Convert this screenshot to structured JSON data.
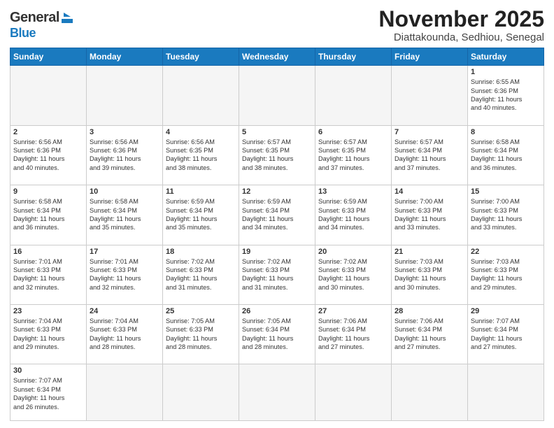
{
  "header": {
    "logo_line1": "General",
    "logo_line2": "Blue",
    "month_title": "November 2025",
    "location": "Diattakounda, Sedhiou, Senegal"
  },
  "weekdays": [
    "Sunday",
    "Monday",
    "Tuesday",
    "Wednesday",
    "Thursday",
    "Friday",
    "Saturday"
  ],
  "weeks": [
    [
      {
        "day": "",
        "info": ""
      },
      {
        "day": "",
        "info": ""
      },
      {
        "day": "",
        "info": ""
      },
      {
        "day": "",
        "info": ""
      },
      {
        "day": "",
        "info": ""
      },
      {
        "day": "",
        "info": ""
      },
      {
        "day": "1",
        "info": "Sunrise: 6:55 AM\nSunset: 6:36 PM\nDaylight: 11 hours\nand 40 minutes."
      }
    ],
    [
      {
        "day": "2",
        "info": "Sunrise: 6:56 AM\nSunset: 6:36 PM\nDaylight: 11 hours\nand 40 minutes."
      },
      {
        "day": "3",
        "info": "Sunrise: 6:56 AM\nSunset: 6:36 PM\nDaylight: 11 hours\nand 39 minutes."
      },
      {
        "day": "4",
        "info": "Sunrise: 6:56 AM\nSunset: 6:35 PM\nDaylight: 11 hours\nand 38 minutes."
      },
      {
        "day": "5",
        "info": "Sunrise: 6:57 AM\nSunset: 6:35 PM\nDaylight: 11 hours\nand 38 minutes."
      },
      {
        "day": "6",
        "info": "Sunrise: 6:57 AM\nSunset: 6:35 PM\nDaylight: 11 hours\nand 37 minutes."
      },
      {
        "day": "7",
        "info": "Sunrise: 6:57 AM\nSunset: 6:34 PM\nDaylight: 11 hours\nand 37 minutes."
      },
      {
        "day": "8",
        "info": "Sunrise: 6:58 AM\nSunset: 6:34 PM\nDaylight: 11 hours\nand 36 minutes."
      }
    ],
    [
      {
        "day": "9",
        "info": "Sunrise: 6:58 AM\nSunset: 6:34 PM\nDaylight: 11 hours\nand 36 minutes."
      },
      {
        "day": "10",
        "info": "Sunrise: 6:58 AM\nSunset: 6:34 PM\nDaylight: 11 hours\nand 35 minutes."
      },
      {
        "day": "11",
        "info": "Sunrise: 6:59 AM\nSunset: 6:34 PM\nDaylight: 11 hours\nand 35 minutes."
      },
      {
        "day": "12",
        "info": "Sunrise: 6:59 AM\nSunset: 6:34 PM\nDaylight: 11 hours\nand 34 minutes."
      },
      {
        "day": "13",
        "info": "Sunrise: 6:59 AM\nSunset: 6:33 PM\nDaylight: 11 hours\nand 34 minutes."
      },
      {
        "day": "14",
        "info": "Sunrise: 7:00 AM\nSunset: 6:33 PM\nDaylight: 11 hours\nand 33 minutes."
      },
      {
        "day": "15",
        "info": "Sunrise: 7:00 AM\nSunset: 6:33 PM\nDaylight: 11 hours\nand 33 minutes."
      }
    ],
    [
      {
        "day": "16",
        "info": "Sunrise: 7:01 AM\nSunset: 6:33 PM\nDaylight: 11 hours\nand 32 minutes."
      },
      {
        "day": "17",
        "info": "Sunrise: 7:01 AM\nSunset: 6:33 PM\nDaylight: 11 hours\nand 32 minutes."
      },
      {
        "day": "18",
        "info": "Sunrise: 7:02 AM\nSunset: 6:33 PM\nDaylight: 11 hours\nand 31 minutes."
      },
      {
        "day": "19",
        "info": "Sunrise: 7:02 AM\nSunset: 6:33 PM\nDaylight: 11 hours\nand 31 minutes."
      },
      {
        "day": "20",
        "info": "Sunrise: 7:02 AM\nSunset: 6:33 PM\nDaylight: 11 hours\nand 30 minutes."
      },
      {
        "day": "21",
        "info": "Sunrise: 7:03 AM\nSunset: 6:33 PM\nDaylight: 11 hours\nand 30 minutes."
      },
      {
        "day": "22",
        "info": "Sunrise: 7:03 AM\nSunset: 6:33 PM\nDaylight: 11 hours\nand 29 minutes."
      }
    ],
    [
      {
        "day": "23",
        "info": "Sunrise: 7:04 AM\nSunset: 6:33 PM\nDaylight: 11 hours\nand 29 minutes."
      },
      {
        "day": "24",
        "info": "Sunrise: 7:04 AM\nSunset: 6:33 PM\nDaylight: 11 hours\nand 28 minutes."
      },
      {
        "day": "25",
        "info": "Sunrise: 7:05 AM\nSunset: 6:33 PM\nDaylight: 11 hours\nand 28 minutes."
      },
      {
        "day": "26",
        "info": "Sunrise: 7:05 AM\nSunset: 6:34 PM\nDaylight: 11 hours\nand 28 minutes."
      },
      {
        "day": "27",
        "info": "Sunrise: 7:06 AM\nSunset: 6:34 PM\nDaylight: 11 hours\nand 27 minutes."
      },
      {
        "day": "28",
        "info": "Sunrise: 7:06 AM\nSunset: 6:34 PM\nDaylight: 11 hours\nand 27 minutes."
      },
      {
        "day": "29",
        "info": "Sunrise: 7:07 AM\nSunset: 6:34 PM\nDaylight: 11 hours\nand 27 minutes."
      }
    ],
    [
      {
        "day": "30",
        "info": "Sunrise: 7:07 AM\nSunset: 6:34 PM\nDaylight: 11 hours\nand 26 minutes."
      },
      {
        "day": "",
        "info": ""
      },
      {
        "day": "",
        "info": ""
      },
      {
        "day": "",
        "info": ""
      },
      {
        "day": "",
        "info": ""
      },
      {
        "day": "",
        "info": ""
      },
      {
        "day": "",
        "info": ""
      }
    ]
  ]
}
